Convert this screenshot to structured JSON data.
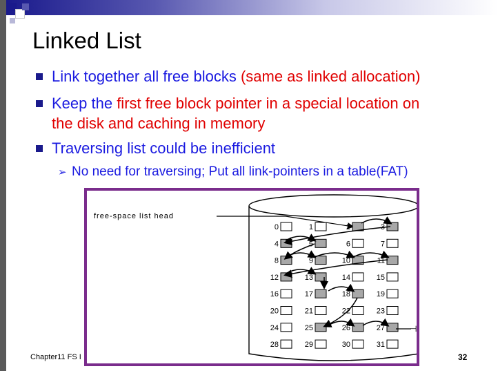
{
  "slide": {
    "title": "Linked List",
    "bullets": [
      {
        "parts": [
          {
            "text": "Link together all free blocks ",
            "color": "blue"
          },
          {
            "text": "(same as linked allocation)",
            "color": "red"
          }
        ]
      },
      {
        "parts": [
          {
            "text": "Keep the ",
            "color": "blue"
          },
          {
            "text": "first free block pointer in a special location on",
            "color": "red"
          }
        ],
        "line2": "the disk and caching in memory"
      },
      {
        "parts": [
          {
            "text": "Traversing list could be inefficient",
            "color": "blue"
          }
        ]
      }
    ],
    "sub_bullet": "No need for traversing; Put all link-pointers in a table(FAT)",
    "footer_left": "Chapter11 FS I",
    "page_number": "32"
  },
  "figure": {
    "head_label": "free-space list head",
    "blocks": [
      "0",
      "1",
      "2",
      "3",
      "4",
      "5",
      "6",
      "7",
      "8",
      "9",
      "10",
      "11",
      "12",
      "13",
      "14",
      "15",
      "16",
      "17",
      "18",
      "19",
      "20",
      "21",
      "22",
      "23",
      "24",
      "25",
      "26",
      "27",
      "28",
      "29",
      "30",
      "31"
    ],
    "free_blocks": [
      2,
      3,
      4,
      5,
      8,
      9,
      10,
      11,
      12,
      13,
      17,
      18,
      25,
      26,
      27
    ]
  },
  "colors": {
    "title_text": "#000000",
    "bullet_blue": "#1a1ae0",
    "highlight_red": "#e00000",
    "figure_border": "#7a2c8c",
    "free_block_fill": "#a8a8a8"
  }
}
